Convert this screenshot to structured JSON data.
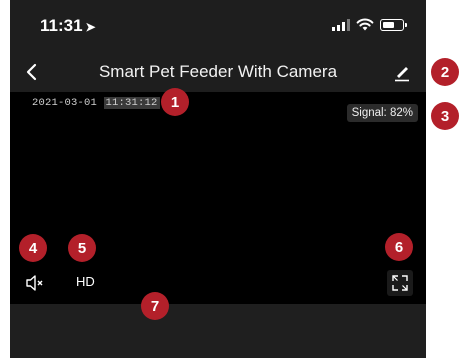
{
  "status_bar": {
    "time": "11:31",
    "location_arrow": "location-arrow-icon",
    "icons": [
      "cellular-signal-icon",
      "wifi-icon",
      "battery-icon"
    ]
  },
  "nav": {
    "title": "Smart Pet Feeder With Camera",
    "back_icon": "chevron-left-icon",
    "edit_icon": "pencil-icon"
  },
  "video": {
    "date": "2021-03-01",
    "time": "11:31:12",
    "signal_label": "Signal:",
    "signal_value": "82%",
    "hd_label": "HD",
    "mute_icon": "speaker-muted-icon",
    "fullscreen_icon": "fullscreen-icon"
  },
  "markers": [
    "1",
    "2",
    "3",
    "4",
    "5",
    "6",
    "7"
  ],
  "colors": {
    "marker_red": "#b3202a",
    "background_dark": "#1e1e1e",
    "video_black": "#000000"
  }
}
